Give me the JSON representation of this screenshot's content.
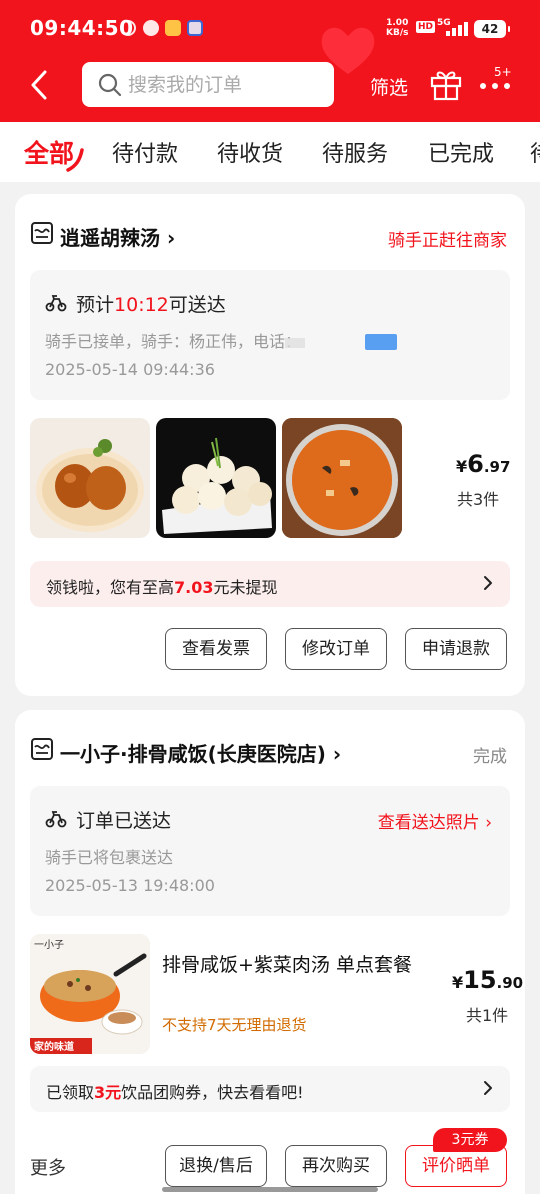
{
  "status_bar": {
    "time": "09:44:50",
    "net_speed_value": "1.00",
    "net_speed_unit": "KB/s",
    "hd": "HD",
    "network": "5G",
    "battery": "42"
  },
  "header": {
    "search_placeholder": "搜索我的订单",
    "filter_label": "筛选",
    "more_badge": "5+"
  },
  "tabs": [
    {
      "label": "全部",
      "active": true
    },
    {
      "label": "待付款"
    },
    {
      "label": "待收货"
    },
    {
      "label": "待服务"
    },
    {
      "label": "已完成"
    },
    {
      "label": "待"
    }
  ],
  "orders": [
    {
      "shop_name": "逍遥胡辣汤",
      "status": "骑手正赶往商家",
      "delivery": {
        "prefix": "预计",
        "eta": "10:12",
        "suffix": "可送达",
        "rider_text": "骑手已接单，骑手：杨正伟，电话：",
        "timestamp": "2025-05-14 09:44:36"
      },
      "items": [
        {
          "name": "tea-eggs",
          "icon": "food-photo"
        },
        {
          "name": "fried-buns",
          "icon": "food-photo"
        },
        {
          "name": "hot-pepper-soup",
          "icon": "food-photo"
        }
      ],
      "price": {
        "currency": "¥",
        "integer": "6",
        "decimal": ".97"
      },
      "count_text": "共3件",
      "promo": {
        "before": "领钱啦，您有至高",
        "amount": "7.03",
        "after": "元未提现"
      },
      "buttons": [
        "查看发票",
        "修改订单",
        "申请退款"
      ]
    },
    {
      "shop_name": "一小子·排骨咸饭(长庚医院店)",
      "status": "完成",
      "delivery": {
        "title": "订单已送达",
        "photos_link": "查看送达照片",
        "rider_text": "骑手已将包裹送达",
        "timestamp": "2025-05-13 19:48:00"
      },
      "item": {
        "title": "排骨咸饭+紫菜肉汤 单点套餐",
        "note": "不支持7天无理由退货",
        "thumb_brand": "一小子",
        "thumb_caption": "家的味道"
      },
      "price": {
        "currency": "¥",
        "integer": "15",
        "decimal": ".90"
      },
      "count_text": "共1件",
      "promo": {
        "before": "已领取",
        "amount": "3元",
        "after": "饮品团购券，快去看看吧!"
      },
      "more_label": "更多",
      "coupon_badge": "3元券",
      "buttons": [
        "退换/售后",
        "再次购买",
        "评价晒单"
      ]
    }
  ],
  "colors": {
    "brand_red": "#f2141d",
    "page_bg": "#f2f2f2",
    "note_orange": "#d26b00"
  }
}
